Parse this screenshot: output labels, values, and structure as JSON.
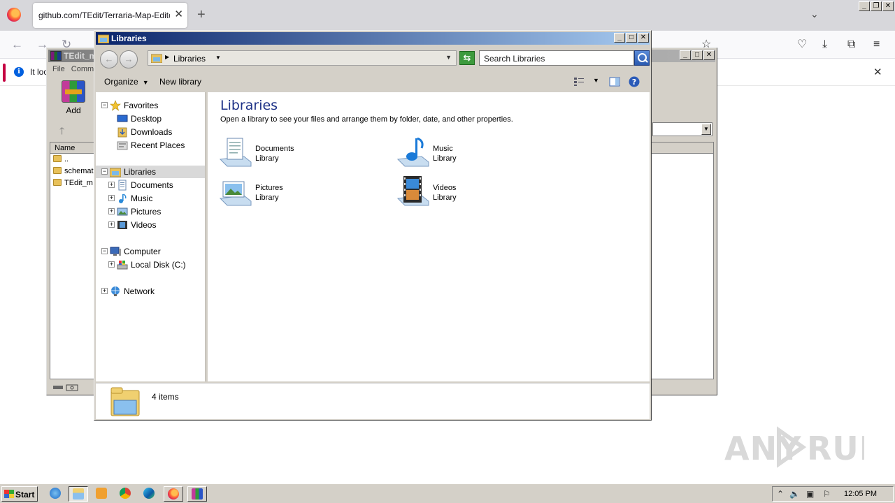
{
  "browser": {
    "tab_title": "github.com/TEdit/Terraria-Map-Editor/r",
    "tab_close": "✕",
    "new_tab": "+",
    "list_tabs": "⌄",
    "notice_text": "It loo",
    "notice_close": "✕"
  },
  "winrar": {
    "title": "TEdit_m",
    "menu": "File   Comm",
    "add_label": "Add",
    "column_name": "Name",
    "rows": [
      "..",
      "schemat",
      "TEdit_m"
    ]
  },
  "explorer": {
    "title": "Libraries",
    "address": "Libraries",
    "search_placeholder": "Search Libraries",
    "organize_label": "Organize",
    "new_library_label": "New library",
    "tree": {
      "favorites": "Favorites",
      "desktop": "Desktop",
      "downloads": "Downloads",
      "recent_places": "Recent Places",
      "libraries": "Libraries",
      "documents": "Documents",
      "music": "Music",
      "pictures": "Pictures",
      "videos": "Videos",
      "computer": "Computer",
      "local_disk": "Local Disk (C:)",
      "network": "Network"
    },
    "content": {
      "heading": "Libraries",
      "description": "Open a library to see your files and arrange them by folder, date, and other properties.",
      "items": [
        {
          "name": "Documents",
          "kind": "Library",
          "icon": "documents-library-icon"
        },
        {
          "name": "Music",
          "kind": "Library",
          "icon": "music-library-icon"
        },
        {
          "name": "Pictures",
          "kind": "Library",
          "icon": "pictures-library-icon"
        },
        {
          "name": "Videos",
          "kind": "Library",
          "icon": "videos-library-icon"
        }
      ]
    },
    "status": "4 items"
  },
  "watermark": "ANY RUN",
  "taskbar": {
    "start_label": "Start",
    "clock": "12:05 PM"
  },
  "colors": {
    "explorer_title_start": "#0a246a",
    "explorer_title_end": "#a6caf0",
    "heading_blue": "#1e3287",
    "system_face": "#d4d0c8"
  }
}
